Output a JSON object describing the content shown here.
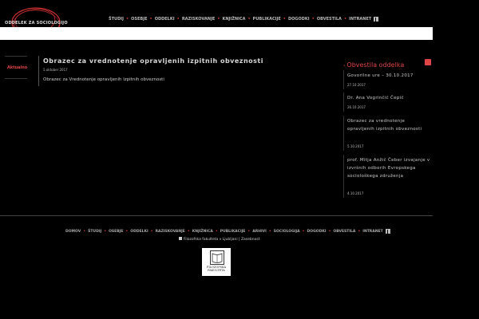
{
  "header": {
    "logo_text": "ODDELEK ZA SOCIOLOGIJO",
    "nav": [
      "ŠTUDIJ",
      "OSEBJE",
      "ODDELKI",
      "RAZISKOVANJE",
      "KNJIŽNICA",
      "PUBLIKACIJE",
      "DOGODKI",
      "OBVESTILA",
      "INTRANET"
    ],
    "facebook_icon": "facebook-icon"
  },
  "sidebar": {
    "active_tab": "Aktualno"
  },
  "article": {
    "title": "Obrazec za vrednotenje opravljenih izpitnih obveznosti",
    "date": "5.oktober 2017",
    "body": "Obrazec za Vrednotenje opravljenih izpitnih obveznosti"
  },
  "news": {
    "heading": "Obvestila oddelka",
    "items": [
      {
        "title": "Govorilne ure – 30.10.2017",
        "date": "27.10.2017"
      },
      {
        "title": "Dr. Ana Vogrinčič Čepič",
        "date": "26.10.2017"
      },
      {
        "title": "Obrazec za vrednotenje opravljenih izpitnih obveznosti",
        "date": "5.10.2017"
      },
      {
        "title": "prof. Mitja Anžič Čeber izvajanje v izvršnih odborih Evropskega sociološkega združenja",
        "date": "4.10.2017"
      }
    ]
  },
  "footer": {
    "nav": [
      "DOMOV",
      "ŠTUDIJ",
      "OSEBJE",
      "ODDELKI",
      "RAZISKOVANJE",
      "KNJIŽNICA",
      "PUBLIKACIJE",
      "ARHIVI",
      "SOCIOLOGIJA",
      "DOGODKI",
      "OBVESTILA",
      "INTRANET"
    ],
    "copyright": "Filozofska fakulteta v Ljubljani | Zasebnost",
    "faculty_logo_text": "FILOZOFSKA FAKULTETA"
  },
  "colors": {
    "background": "#000000",
    "accent": "#e04545",
    "text": "#cccccc"
  }
}
